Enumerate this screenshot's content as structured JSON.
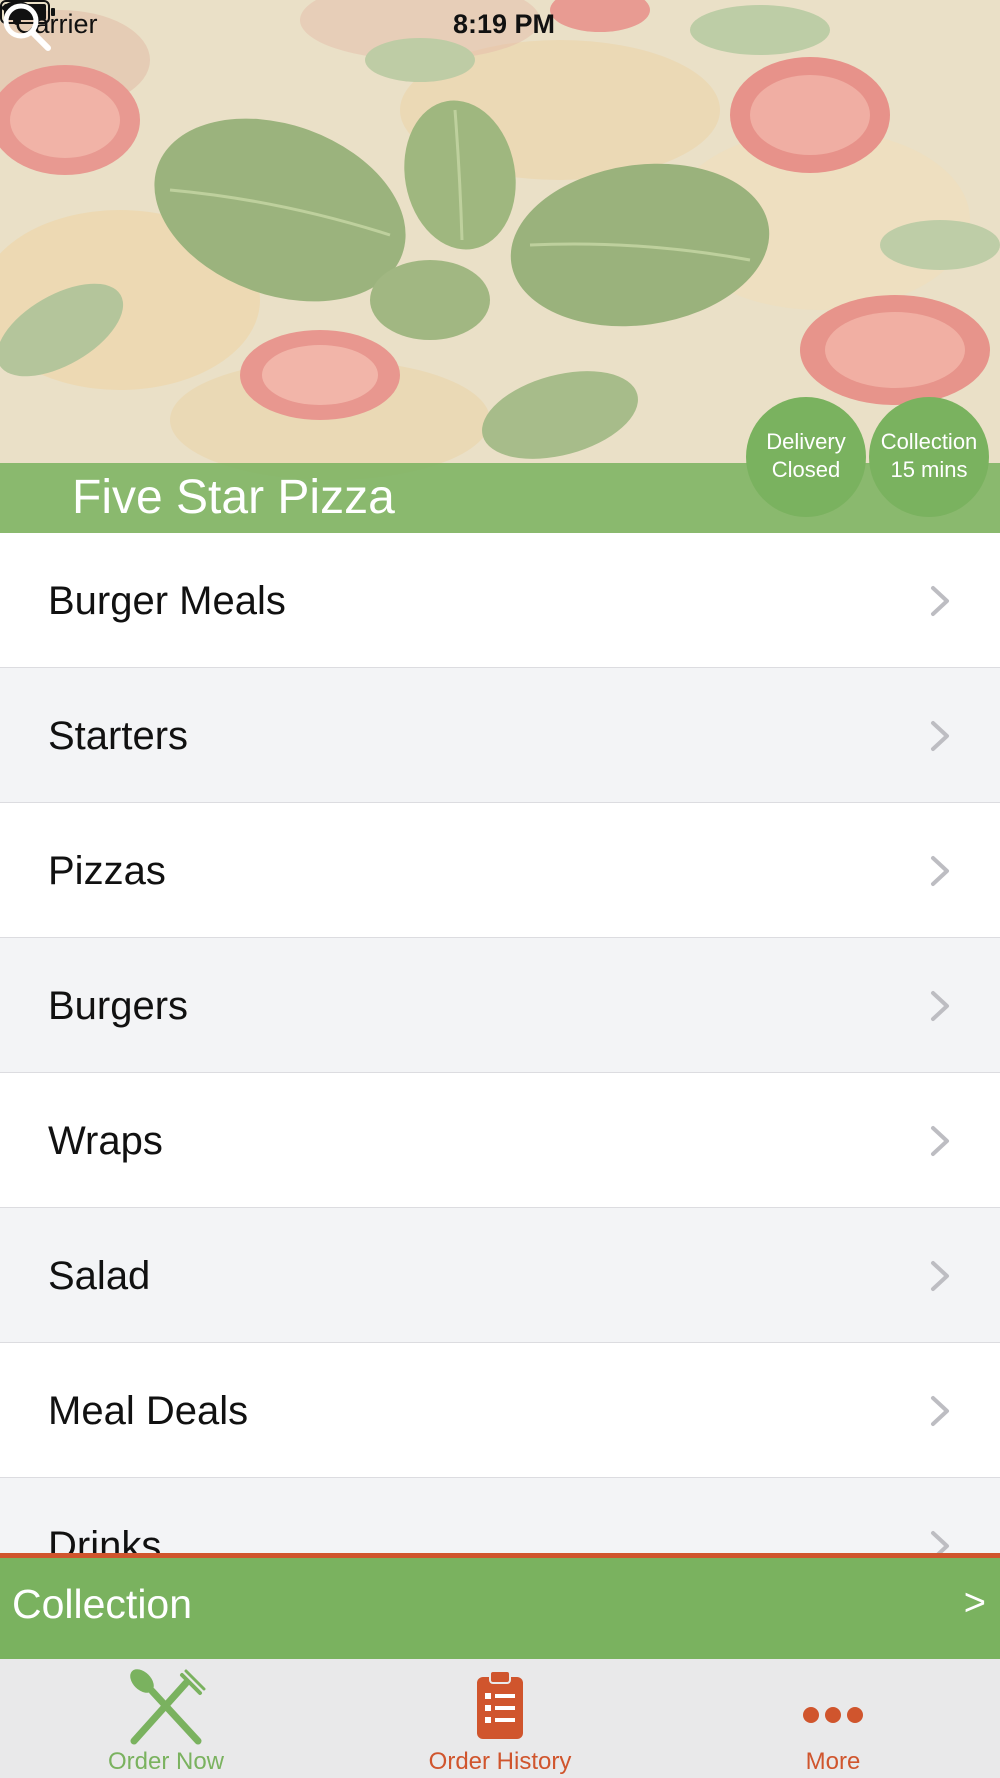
{
  "status_bar": {
    "carrier": "Carrier",
    "time": "8:19 PM",
    "wifi_icon": "wifi-icon",
    "battery_icon": "battery-icon"
  },
  "header": {
    "restaurant_name": "Five Star Pizza",
    "search_icon": "search-icon",
    "delivery": {
      "line1": "Delivery",
      "line2": "Closed"
    },
    "collection": {
      "line1": "Collection",
      "line2": "15 mins"
    }
  },
  "menu": {
    "items": [
      {
        "label": "Burger Meals"
      },
      {
        "label": "Starters"
      },
      {
        "label": "Pizzas"
      },
      {
        "label": "Burgers"
      },
      {
        "label": "Wraps"
      },
      {
        "label": "Salad"
      },
      {
        "label": "Meal Deals"
      },
      {
        "label": "Drinks"
      }
    ],
    "chevron_icon": "chevron-right-icon"
  },
  "collection_bar": {
    "label": "Collection",
    "arrow": ">"
  },
  "tab_bar": {
    "tabs": [
      {
        "label": "Order Now",
        "icon": "fork-knife-icon"
      },
      {
        "label": "Order History",
        "icon": "clipboard-icon"
      },
      {
        "label": "More",
        "icon": "more-dots-icon"
      }
    ]
  },
  "colors": {
    "brand_green": "#7ab25f",
    "accent_orange": "#d0552d",
    "row_alt": "#f3f4f6",
    "tab_bar_bg": "#e9e9ea"
  }
}
